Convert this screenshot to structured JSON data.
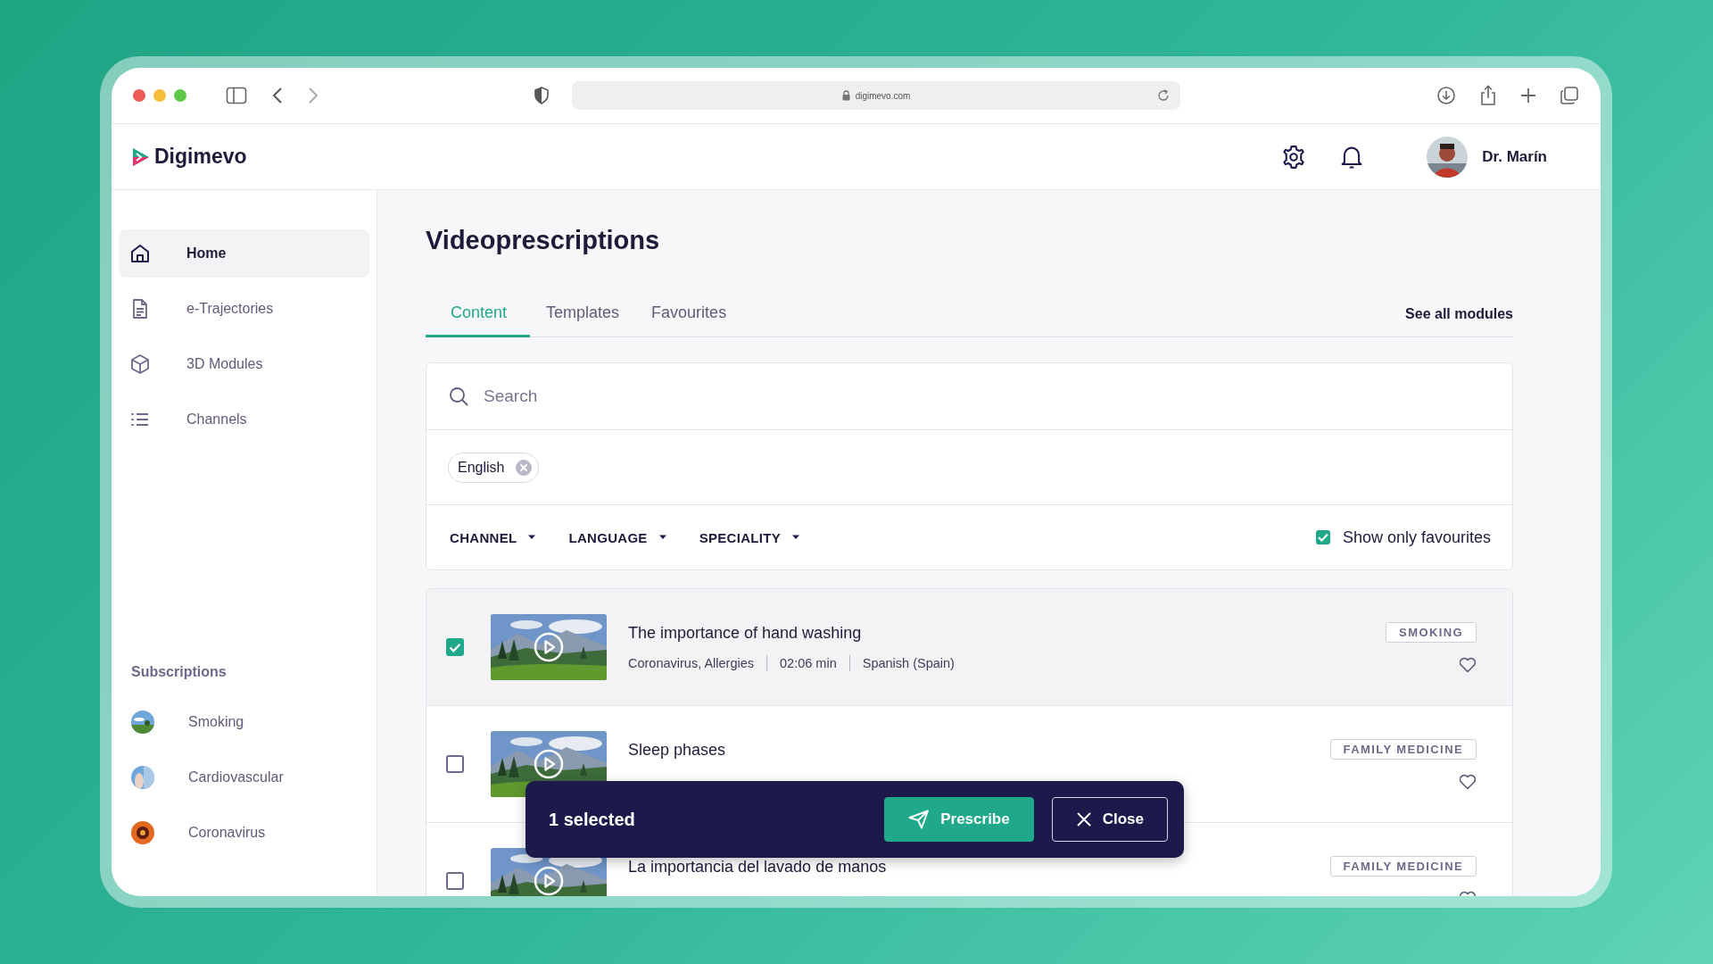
{
  "browser": {
    "url": "digimevo.com"
  },
  "app": {
    "name": "Digimevo"
  },
  "user": {
    "name": "Dr. Marín"
  },
  "sidebar": {
    "items": [
      {
        "label": "Home",
        "selected": true,
        "kind": "home"
      },
      {
        "label": "e-Trajectories",
        "selected": false,
        "kind": "document"
      },
      {
        "label": "3D Modules",
        "selected": false,
        "kind": "cube"
      },
      {
        "label": "Channels",
        "selected": false,
        "kind": "list"
      }
    ],
    "subscriptions_title": "Subscriptions",
    "subscriptions": [
      {
        "label": "Smoking"
      },
      {
        "label": "Cardiovascular"
      },
      {
        "label": "Coronavirus"
      }
    ]
  },
  "page": {
    "title": "Videoprescriptions",
    "see_all": "See all modules",
    "tabs": [
      {
        "label": "Content",
        "selected": true
      },
      {
        "label": "Templates",
        "selected": false
      },
      {
        "label": "Favourites",
        "selected": false
      }
    ]
  },
  "search": {
    "placeholder": "Search"
  },
  "chips": [
    {
      "label": "English"
    }
  ],
  "filters": [
    {
      "label": "CHANNEL"
    },
    {
      "label": "LANGUAGE"
    },
    {
      "label": "SPECIALITY"
    }
  ],
  "favourites_toggle": {
    "label": "Show only favourites",
    "checked": true
  },
  "videos": [
    {
      "title": "The importance of hand washing",
      "topics": "Coronavirus, Allergies",
      "duration": "02:06 min",
      "language": "Spanish (Spain)",
      "tag": "SMOKING",
      "checked": true
    },
    {
      "title": "Sleep phases",
      "tag": "FAMILY MEDICINE",
      "checked": false
    },
    {
      "title": "La importancia del lavado de manos",
      "tag": "FAMILY MEDICINE",
      "checked": false
    }
  ],
  "toast": {
    "count": "1 selected",
    "actions": [
      {
        "label": "Prescribe",
        "kind": "primary"
      },
      {
        "label": "Close",
        "kind": "secondary"
      }
    ]
  }
}
